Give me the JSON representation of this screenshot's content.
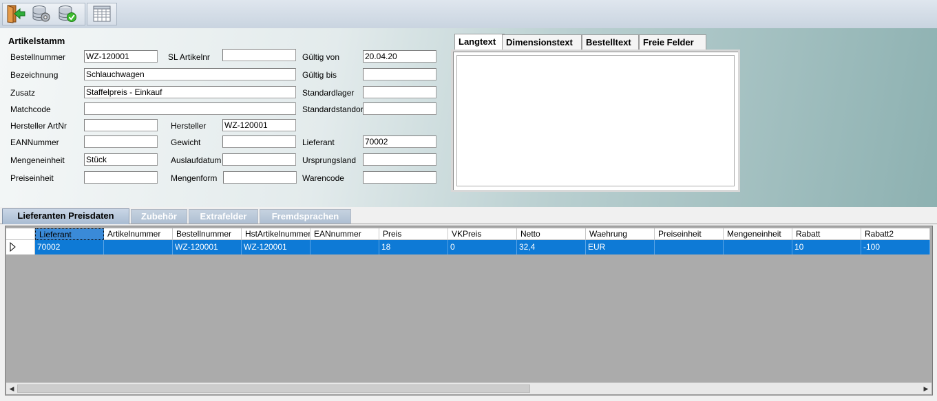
{
  "toolbar": {
    "buttons": [
      {
        "icon": "exit-door-icon"
      },
      {
        "icon": "database-settings-icon"
      },
      {
        "icon": "database-check-icon"
      },
      {
        "icon": "table-grid-icon"
      }
    ]
  },
  "artikelstamm": {
    "title": "Artikelstamm",
    "bestellnummer": {
      "label": "Bestellnummer",
      "value": "WZ-120001"
    },
    "sl_artikelnr": {
      "label": "SL Artikelnr",
      "value": ""
    },
    "gueltig_von": {
      "label": "Gültig von",
      "value": "20.04.20"
    },
    "bezeichnung": {
      "label": "Bezeichnung",
      "value": "Schlauchwagen"
    },
    "gueltig_bis": {
      "label": "Gültig bis",
      "value": ""
    },
    "zusatz": {
      "label": "Zusatz",
      "value": "Staffelpreis - Einkauf"
    },
    "standardlager": {
      "label": "Standardlager",
      "value": ""
    },
    "matchcode": {
      "label": "Matchcode",
      "value": ""
    },
    "standardstandort": {
      "label": "Standardstandort",
      "value": ""
    },
    "hersteller_artnr": {
      "label": "Hersteller ArtNr",
      "value": ""
    },
    "hersteller": {
      "label": "Hersteller",
      "value": "WZ-120001"
    },
    "eannummer": {
      "label": "EANNummer",
      "value": ""
    },
    "gewicht": {
      "label": "Gewicht",
      "value": ""
    },
    "lieferant": {
      "label": "Lieferant",
      "value": "70002"
    },
    "mengeneinheit": {
      "label": "Mengeneinheit",
      "value": "Stück"
    },
    "auslaufdatum": {
      "label": "Auslaufdatum",
      "value": ""
    },
    "ursprungsland": {
      "label": "Ursprungsland",
      "value": ""
    },
    "preiseinheit": {
      "label": "Preiseinheit",
      "value": ""
    },
    "mengenform": {
      "label": "Mengenform",
      "value": ""
    },
    "warencode": {
      "label": "Warencode",
      "value": ""
    }
  },
  "text_tabs": [
    "Langtext",
    "Dimensionstext",
    "Bestelltext",
    "Freie Felder"
  ],
  "text_area_value": "",
  "lower_tabs": [
    "Lieferanten Preisdaten",
    "Zubehör",
    "Extrafelder",
    "Fremdsprachen"
  ],
  "grid": {
    "columns": [
      "Lieferant",
      "Artikelnummer",
      "Bestellnummer",
      "HstArtikelnummer",
      "EANnummer",
      "Preis",
      "VKPreis",
      "Netto",
      "Waehrung",
      "Preiseinheit",
      "Mengeneinheit",
      "Rabatt",
      "Rabatt2"
    ],
    "rows": [
      [
        "70002",
        "",
        "WZ-120001",
        "WZ-120001",
        "",
        "18",
        "0",
        "32,4",
        "EUR",
        "",
        "",
        "10",
        "-100"
      ]
    ]
  }
}
